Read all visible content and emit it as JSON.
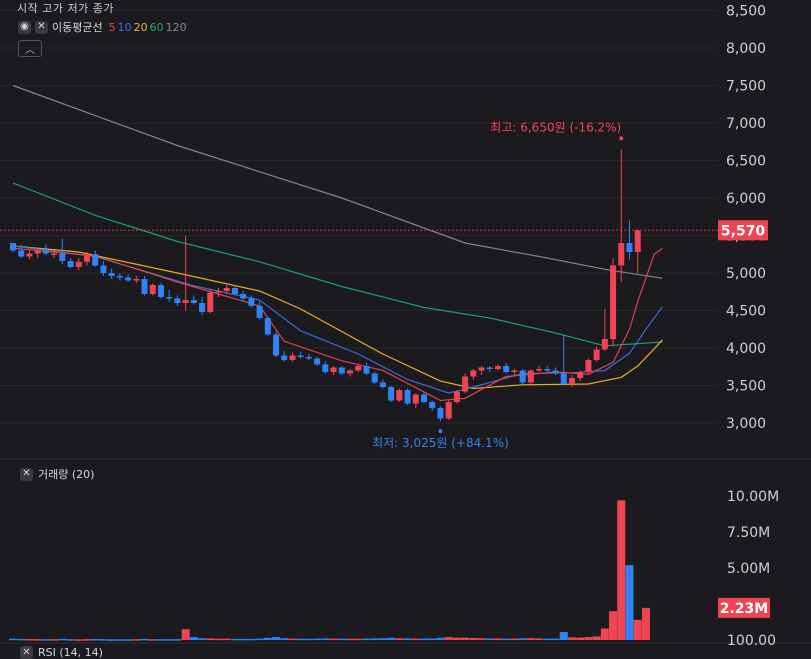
{
  "legend": {
    "ohlc_labels": "시작 고가 저가 종가",
    "ma_title": "이동평균선",
    "ma_periods": [
      {
        "label": "5",
        "color": "#e8434e"
      },
      {
        "label": "10",
        "color": "#3d6fe0"
      },
      {
        "label": "20",
        "color": "#f0b429"
      },
      {
        "label": "60",
        "color": "#1aa86a"
      },
      {
        "label": "120",
        "color": "#8a8a8e"
      }
    ],
    "volume_title": "거래량 (20)",
    "rsi_title": "RSI (14, 14)"
  },
  "colors": {
    "background": "#1b1b1f",
    "up": "#f04452",
    "down": "#3182f6",
    "current_price_tag": "#f04452"
  },
  "chart_data": [
    {
      "type": "candlestick",
      "price_axis": {
        "ticks": [
          "8,500",
          "8,000",
          "7,500",
          "7,000",
          "6,500",
          "6,000",
          "5,500",
          "5,000",
          "4,500",
          "4,000",
          "3,500",
          "3,000"
        ],
        "tick_values": [
          8500,
          8000,
          7500,
          7000,
          6500,
          6000,
          5500,
          5000,
          4500,
          4000,
          3500,
          3000
        ]
      },
      "current_price": {
        "value": 5570,
        "label": "5,570"
      },
      "high_annotation": {
        "value": 6650,
        "label": "최고: 6,650원 (-16.2%)"
      },
      "low_annotation": {
        "value": 3025,
        "label": "최저: 3,025원 (+84.1%)"
      },
      "candles": [
        [
          5400,
          5400,
          5280,
          5300
        ],
        [
          5300,
          5380,
          5200,
          5220
        ],
        [
          5220,
          5300,
          5180,
          5260
        ],
        [
          5260,
          5320,
          5200,
          5300
        ],
        [
          5300,
          5380,
          5240,
          5260
        ],
        [
          5260,
          5300,
          5200,
          5260
        ],
        [
          5260,
          5460,
          5120,
          5160
        ],
        [
          5160,
          5200,
          5060,
          5080
        ],
        [
          5080,
          5200,
          5040,
          5150
        ],
        [
          5150,
          5280,
          5100,
          5250
        ],
        [
          5250,
          5300,
          5080,
          5100
        ],
        [
          5100,
          5160,
          4960,
          5000
        ],
        [
          5000,
          5060,
          4920,
          4960
        ],
        [
          4960,
          5000,
          4900,
          4940
        ],
        [
          4940,
          4980,
          4880,
          4900
        ],
        [
          4900,
          4960,
          4860,
          4920
        ],
        [
          4920,
          4960,
          4700,
          4720
        ],
        [
          4720,
          4860,
          4700,
          4840
        ],
        [
          4840,
          4870,
          4660,
          4680
        ],
        [
          4680,
          4780,
          4620,
          4660
        ],
        [
          4660,
          4700,
          4560,
          4600
        ],
        [
          4600,
          5500,
          4500,
          4640
        ],
        [
          4640,
          4700,
          4580,
          4600
        ],
        [
          4600,
          4680,
          4440,
          4480
        ],
        [
          4480,
          4780,
          4460,
          4740
        ],
        [
          4740,
          4800,
          4680,
          4760
        ],
        [
          4760,
          4840,
          4720,
          4800
        ],
        [
          4800,
          4830,
          4700,
          4720
        ],
        [
          4720,
          4760,
          4620,
          4660
        ],
        [
          4660,
          4700,
          4540,
          4560
        ],
        [
          4560,
          4620,
          4380,
          4400
        ],
        [
          4400,
          4420,
          4160,
          4180
        ],
        [
          4180,
          4220,
          3880,
          3900
        ],
        [
          3900,
          3960,
          3820,
          3840
        ],
        [
          3840,
          3940,
          3820,
          3900
        ],
        [
          3900,
          3950,
          3860,
          3880
        ],
        [
          3880,
          3920,
          3840,
          3860
        ],
        [
          3860,
          3880,
          3760,
          3780
        ],
        [
          3780,
          3820,
          3660,
          3680
        ],
        [
          3680,
          3760,
          3640,
          3740
        ],
        [
          3740,
          3760,
          3640,
          3660
        ],
        [
          3660,
          3720,
          3620,
          3700
        ],
        [
          3700,
          3780,
          3680,
          3760
        ],
        [
          3760,
          3800,
          3640,
          3660
        ],
        [
          3660,
          3680,
          3520,
          3540
        ],
        [
          3540,
          3580,
          3460,
          3480
        ],
        [
          3480,
          3500,
          3280,
          3300
        ],
        [
          3300,
          3460,
          3280,
          3440
        ],
        [
          3440,
          3460,
          3240,
          3260
        ],
        [
          3260,
          3400,
          3200,
          3380
        ],
        [
          3380,
          3420,
          3260,
          3280
        ],
        [
          3280,
          3300,
          3160,
          3200
        ],
        [
          3200,
          3220,
          3025,
          3060
        ],
        [
          3060,
          3300,
          3040,
          3280
        ],
        [
          3280,
          3440,
          3260,
          3420
        ],
        [
          3420,
          3660,
          3400,
          3620
        ],
        [
          3620,
          3720,
          3580,
          3700
        ],
        [
          3700,
          3760,
          3640,
          3740
        ],
        [
          3740,
          3760,
          3680,
          3720
        ],
        [
          3720,
          3780,
          3700,
          3760
        ],
        [
          3760,
          3800,
          3660,
          3680
        ],
        [
          3680,
          3720,
          3620,
          3700
        ],
        [
          3700,
          3720,
          3520,
          3540
        ],
        [
          3540,
          3720,
          3520,
          3700
        ],
        [
          3700,
          3760,
          3680,
          3720
        ],
        [
          3720,
          3760,
          3660,
          3700
        ],
        [
          3700,
          3740,
          3640,
          3660
        ],
        [
          3660,
          4180,
          3500,
          3520
        ],
        [
          3520,
          3640,
          3480,
          3600
        ],
        [
          3600,
          3700,
          3560,
          3680
        ],
        [
          3680,
          3860,
          3660,
          3840
        ],
        [
          3840,
          4020,
          3820,
          3980
        ],
        [
          3980,
          4520,
          3960,
          4120
        ],
        [
          4120,
          5200,
          4020,
          5100
        ],
        [
          5100,
          6650,
          4880,
          5400
        ],
        [
          5400,
          5700,
          5180,
          5280
        ],
        [
          5280,
          5580,
          5000,
          5570
        ]
      ],
      "ma_lines": {
        "ma5": [
          [
            0,
            5330
          ],
          [
            10,
            5230
          ],
          [
            20,
            4880
          ],
          [
            30,
            4560
          ],
          [
            33,
            4090
          ],
          [
            40,
            3830
          ],
          [
            45,
            3700
          ],
          [
            52,
            3300
          ],
          [
            55,
            3330
          ],
          [
            60,
            3620
          ],
          [
            66,
            3680
          ],
          [
            70,
            3650
          ],
          [
            73,
            3810
          ],
          [
            75,
            4250
          ],
          [
            76,
            4620
          ],
          [
            78,
            5250
          ],
          [
            79,
            5330
          ]
        ],
        "ma10": [
          [
            0,
            5360
          ],
          [
            10,
            5220
          ],
          [
            22,
            4830
          ],
          [
            30,
            4640
          ],
          [
            35,
            4230
          ],
          [
            42,
            3920
          ],
          [
            48,
            3580
          ],
          [
            53,
            3400
          ],
          [
            56,
            3480
          ],
          [
            62,
            3660
          ],
          [
            68,
            3670
          ],
          [
            72,
            3700
          ],
          [
            75,
            3930
          ],
          [
            77,
            4250
          ],
          [
            79,
            4550
          ]
        ],
        "ma20": [
          [
            0,
            5360
          ],
          [
            8,
            5280
          ],
          [
            20,
            5000
          ],
          [
            30,
            4760
          ],
          [
            35,
            4520
          ],
          [
            45,
            3920
          ],
          [
            52,
            3560
          ],
          [
            56,
            3460
          ],
          [
            62,
            3510
          ],
          [
            70,
            3520
          ],
          [
            74,
            3610
          ],
          [
            76,
            3760
          ],
          [
            78,
            3990
          ],
          [
            79,
            4110
          ]
        ],
        "ma60": [
          [
            0,
            6200
          ],
          [
            10,
            5770
          ],
          [
            20,
            5420
          ],
          [
            30,
            5150
          ],
          [
            40,
            4820
          ],
          [
            50,
            4540
          ],
          [
            58,
            4400
          ],
          [
            66,
            4200
          ],
          [
            72,
            4030
          ],
          [
            79,
            4080
          ]
        ],
        "ma120": [
          [
            0,
            7500
          ],
          [
            20,
            6700
          ],
          [
            40,
            6000
          ],
          [
            55,
            5400
          ],
          [
            65,
            5200
          ],
          [
            72,
            5050
          ],
          [
            79,
            4930
          ]
        ]
      }
    },
    {
      "type": "bar",
      "title": "거래량 (20)",
      "axis_ticks": [
        "10.00M",
        "7.50M",
        "5.00M",
        "100.00"
      ],
      "axis_tick_values": [
        10000000,
        7500000,
        5000000,
        100
      ],
      "current_volume_label": "2.23M",
      "values": [
        90000,
        80000,
        70000,
        60000,
        60000,
        60000,
        80000,
        60000,
        50000,
        60000,
        70000,
        60000,
        50000,
        50000,
        50000,
        60000,
        80000,
        60000,
        60000,
        60000,
        60000,
        750000,
        200000,
        120000,
        110000,
        90000,
        100000,
        80000,
        80000,
        80000,
        100000,
        150000,
        200000,
        120000,
        100000,
        90000,
        90000,
        100000,
        110000,
        100000,
        100000,
        90000,
        90000,
        100000,
        110000,
        120000,
        150000,
        120000,
        110000,
        100000,
        100000,
        110000,
        150000,
        200000,
        160000,
        170000,
        140000,
        120000,
        110000,
        110000,
        100000,
        100000,
        120000,
        130000,
        110000,
        100000,
        100000,
        550000,
        180000,
        170000,
        200000,
        250000,
        800000,
        2000000,
        9700000,
        5200000,
        1400000,
        2230000
      ]
    }
  ]
}
